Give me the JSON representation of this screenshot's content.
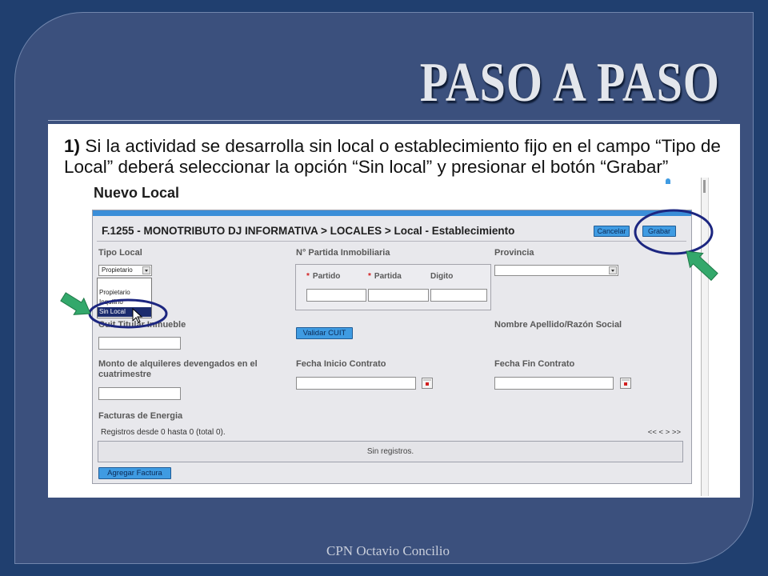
{
  "slide": {
    "title": "PASO A PASO",
    "footer": "CPN Octavio Concilio"
  },
  "colors": {
    "slide_background": "#203f6f",
    "slide_panel": "#3b507d",
    "button_blue": "#3f9be2",
    "selected_option": "#1b2b6e",
    "required_red": "#d22020",
    "highlight_navy": "#1c2680",
    "annotation_green": "#33a86b"
  },
  "instruction": {
    "number": "1)",
    "text": "Si la actividad se desarrolla sin local o establecimiento fijo en el campo “Tipo de Local” deberá seleccionar la opción “Sin local” y presionar el botón “Grabar”"
  },
  "screen": {
    "page_title": "Nuevo Local",
    "form": {
      "breadcrumb": "F.1255 - MONOTRIBUTO DJ INFORMATIVA > LOCALES > Local - Establecimiento",
      "buttons": {
        "cancel": "Cancelar",
        "save": "Grabar",
        "validate_cuit": "Validar CUIT",
        "add_invoice": "Agregar Factura"
      },
      "tipo_local": {
        "label": "Tipo Local",
        "value": "Propietario",
        "options": [
          "Propietario",
          "Inquilino",
          "Sin Local"
        ],
        "highlighted_index": 2
      },
      "partida": {
        "label": "N° Partida Inmobiliaria",
        "required_mark": "*",
        "partido_label": "Partido",
        "partida_label": "Partida",
        "digito_label": "Digito"
      },
      "provincia": {
        "label": "Provincia"
      },
      "cuit_titular": {
        "label": "Cuit Titular Inmueble"
      },
      "nombre": {
        "label": "Nombre Apellido/Razón Social"
      },
      "monto": {
        "label": "Monto de alquileres devengados en el cuatrimestre"
      },
      "fecha_inicio": {
        "label": "Fecha Inicio Contrato"
      },
      "fecha_fin": {
        "label": "Fecha Fin Contrato"
      },
      "facturas": {
        "label": "Facturas de Energia",
        "pagination_info": "Registros desde 0 hasta 0 (total 0).",
        "pager": "<< < > >>",
        "empty_message": "Sin registros."
      }
    }
  },
  "icons": {
    "calendar": "calendar-icon",
    "dropdown": "dropdown-arrow-icon",
    "cursor": "mouse-cursor-icon"
  }
}
